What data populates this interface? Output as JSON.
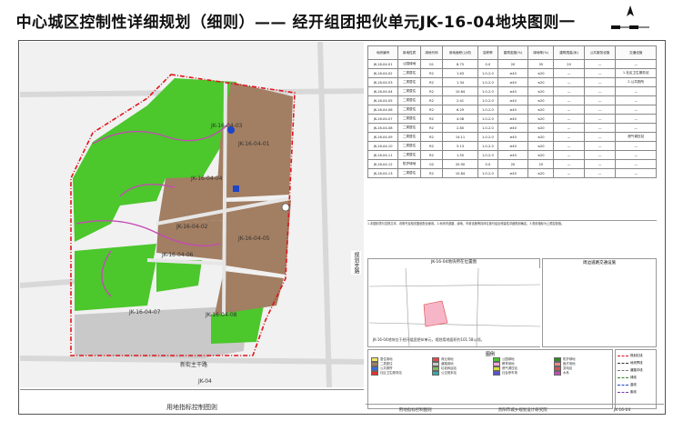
{
  "title": "中心城区控制性详细规划（细则）—— 经开组团把伙单元JK-16-04地块图则一",
  "map": {
    "parcels": [
      {
        "code": "JK-16-04-01"
      },
      {
        "code": "JK-16-04-02"
      },
      {
        "code": "JK-16-04-03"
      },
      {
        "code": "JK-16-04-04"
      },
      {
        "code": "JK-16-04-05"
      },
      {
        "code": "JK-16-04-06"
      },
      {
        "code": "JK-16-04-07"
      },
      {
        "code": "JK-16-04-08"
      }
    ],
    "road_labels": [
      "JK-16-05",
      "JK-16-04",
      "JK-16-03",
      "JK-16-08",
      "JK-04"
    ],
    "road_name_left": "规划支路",
    "road_name_bottom": "新街主干路",
    "colors": {
      "green": "#4cc72c",
      "brown": "#a27e62",
      "gray": "#c9c9c9",
      "boundary": "#e0141c",
      "stream": "#c44bb4"
    }
  },
  "map_caption": "用地指标控制图则",
  "table": {
    "headers": [
      "地块编号",
      "用地性质",
      "用地代码",
      "用地面积(公顷)",
      "容积率",
      "建筑密度(%)",
      "绿地率(%)",
      "建筑限高(米)",
      "公共服务设施",
      "交通设施"
    ],
    "rows": [
      [
        "JK-16-04-01",
        "公园绿地",
        "G1",
        "8.75",
        "0.0",
        "20",
        "35",
        "20",
        "—",
        "—"
      ],
      [
        "JK-16-04-02",
        "二类居住",
        "R2",
        "1.63",
        "1.0-2.0",
        "≥40",
        "≤20",
        "—",
        "—",
        "1.社区卫生服务站"
      ],
      [
        "JK-16-04-03",
        "二类居住",
        "R2",
        "1.34",
        "1.0-2.0",
        "≥40",
        "≤20",
        "—",
        "—",
        "2.公共厕所"
      ],
      [
        "JK-16-04-04",
        "二类居住",
        "R2",
        "10.84",
        "1.0-2.0",
        "≥40",
        "≤20",
        "—",
        "—",
        "—"
      ],
      [
        "JK-16-04-05",
        "二类居住",
        "R2",
        "2.41",
        "1.0-2.0",
        "≥40",
        "≤20",
        "—",
        "—",
        "—"
      ],
      [
        "JK-16-04-06",
        "二类居住",
        "R2",
        "6.29",
        "1.0-2.0",
        "≥40",
        "≤20",
        "—",
        "—",
        "—"
      ],
      [
        "JK-16-04-07",
        "二类居住",
        "R2",
        "4.08",
        "1.0-2.0",
        "≥40",
        "≤20",
        "—",
        "—",
        "—"
      ],
      [
        "JK-16-04-08",
        "二类居住",
        "R2",
        "2.80",
        "1.0-2.0",
        "≥40",
        "≤20",
        "—",
        "—",
        "—"
      ],
      [
        "JK-16-04-09",
        "二类居住",
        "R2",
        "14.11",
        "1.0-2.0",
        "≥40",
        "≤20",
        "—",
        "—",
        "燃气调压站"
      ],
      [
        "JK-16-04-10",
        "二类居住",
        "R2",
        "5.13",
        "1.0-2.0",
        "≥40",
        "≤20",
        "—",
        "—",
        "—"
      ],
      [
        "JK-16-04-11",
        "二类居住",
        "R2",
        "1.55",
        "1.0-2.0",
        "≥40",
        "≤20",
        "—",
        "—",
        "—"
      ],
      [
        "JK-16-04-12",
        "防护绿地",
        "G2",
        "20.90",
        "0.0",
        "20",
        "20",
        "—",
        "—",
        "—"
      ],
      [
        "JK-16-04-13",
        "二类居住",
        "R2",
        "10.84",
        "1.0-2.0",
        "≥40",
        "≤20",
        "—",
        "—",
        "—"
      ]
    ]
  },
  "notes": "1.本图则须与控规文本、说明书及相关图纸配合使用。2.地块内道路、绿地、市政设施等具体位置可结合修建性详细规划确定。3.规划指标为上限控制值。",
  "location_title": "JK-16-04地块所在位置图",
  "location_text": "JK-16-04地块位于经开组团把伙单元，规划用地面积约101.58公顷。",
  "station_title": "周边道路交通设施",
  "legend_title": "图例",
  "legend_items": [
    {
      "label": "居住用地",
      "color": "#f5e56b"
    },
    {
      "label": "商业用地",
      "color": "#e34b4b"
    },
    {
      "label": "公园绿地",
      "color": "#4cc72c"
    },
    {
      "label": "防护绿地",
      "color": "#2f8a1f"
    },
    {
      "label": "二类居住",
      "color": "#a27e62"
    },
    {
      "label": "道路用地",
      "color": "#c9c9c9"
    },
    {
      "label": "教育用地",
      "color": "#f2a7d8"
    },
    {
      "label": "医疗用地",
      "color": "#e88"
    },
    {
      "label": "公共厕所",
      "color": "#3a6ad4"
    },
    {
      "label": "垃圾转运站",
      "color": "#8b5"
    },
    {
      "label": "燃气调压站",
      "color": "#dd4"
    },
    {
      "label": "变电站",
      "color": "#c55"
    },
    {
      "label": "社区卫生服务站",
      "color": "#d33"
    },
    {
      "label": "公交首末站",
      "color": "#3aa"
    },
    {
      "label": "社会停车场",
      "color": "#55c"
    },
    {
      "label": "水系",
      "color": "#c44bb4"
    }
  ],
  "line_legend": [
    "规划红线",
    "地块界线",
    "道路中线",
    "绿线",
    "蓝线",
    "紫线"
  ],
  "footer": {
    "left": "用地指标控制图则",
    "middle": "贵阳市城乡规划设计研究院",
    "right": "JK-16-04"
  }
}
